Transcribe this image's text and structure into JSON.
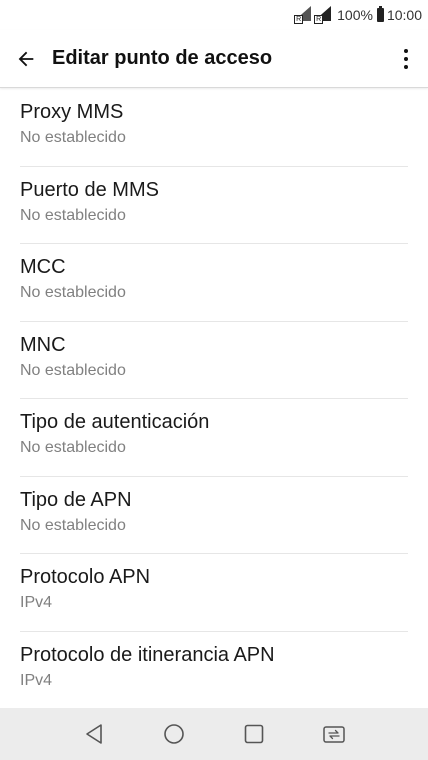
{
  "status_bar": {
    "battery_percent": "100%",
    "time": "10:00"
  },
  "app_bar": {
    "title": "Editar punto de acceso",
    "back_icon": "arrow-back-icon",
    "menu_icon": "more-vert-icon"
  },
  "settings": [
    {
      "title": "Proxy MMS",
      "summary": "No establecido"
    },
    {
      "title": "Puerto de MMS",
      "summary": "No establecido"
    },
    {
      "title": "MCC",
      "summary": "No establecido"
    },
    {
      "title": "MNC",
      "summary": "No establecido"
    },
    {
      "title": "Tipo de autenticación",
      "summary": "No establecido"
    },
    {
      "title": "Tipo de APN",
      "summary": "No establecido"
    },
    {
      "title": "Protocolo APN",
      "summary": "IPv4"
    },
    {
      "title": "Protocolo de itinerancia APN",
      "summary": "IPv4"
    }
  ],
  "nav_bar": {
    "icons": [
      "back-triangle-icon",
      "home-circle-icon",
      "recents-square-icon",
      "dual-window-icon"
    ],
    "background": "#ececec"
  }
}
